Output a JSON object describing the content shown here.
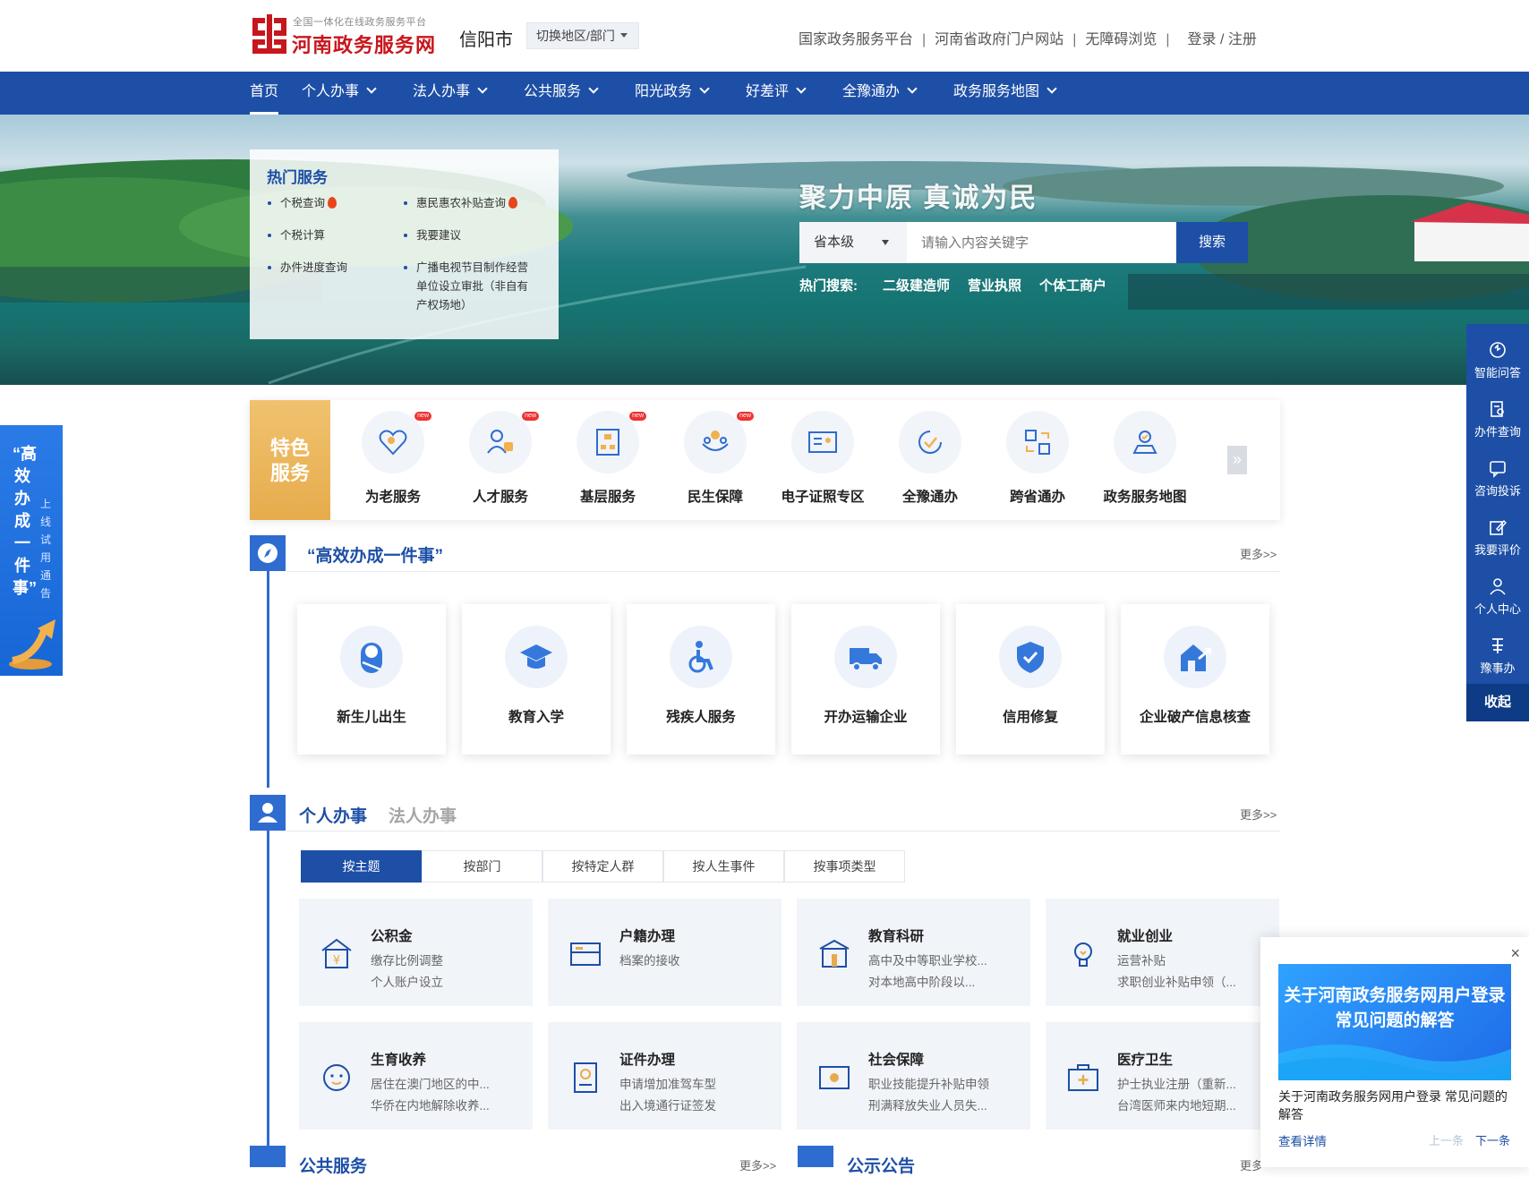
{
  "header": {
    "logo_sub": "全国一体化在线政务服务平台",
    "logo_title": "河南政务服务网",
    "city": "信阳市",
    "switch_label": "切换地区/部门",
    "links": [
      "国家政务服务平台",
      "河南省政府门户网站",
      "无障碍浏览",
      "登录 / 注册"
    ]
  },
  "nav": {
    "items": [
      "首页",
      "个人办事",
      "法人办事",
      "公共服务",
      "阳光政务",
      "好差评",
      "全豫通办",
      "政务服务地图"
    ]
  },
  "hot_services": {
    "title": "热门服务",
    "items": [
      "个税查询",
      "惠民惠农补贴查询",
      "个税计算",
      "我要建议",
      "办件进度查询",
      "广播电视节目制作经营单位设立审批（非自有产权场地）"
    ]
  },
  "search": {
    "slogan": "聚力中原  真诚为民",
    "level": "省本级",
    "placeholder": "请输入内容关键字",
    "button": "搜索",
    "hot_label": "热门搜索:",
    "hot_keywords": [
      "二级建造师",
      "营业执照",
      "个体工商户"
    ]
  },
  "right_bar": {
    "items": [
      "智能问答",
      "办件查询",
      "咨询投诉",
      "我要评价",
      "个人中心",
      "豫事办"
    ],
    "collapse": "收起"
  },
  "left_float": {
    "big": "“高效办成一件事”",
    "small": "上线试用通告"
  },
  "featured": {
    "label": "特色服务",
    "items": [
      "为老服务",
      "人才服务",
      "基层服务",
      "民生保障",
      "电子证照专区",
      "全豫通办",
      "跨省通办",
      "政务服务地图"
    ],
    "new_badge": "new"
  },
  "efficient": {
    "title": "“高效办成一件事”",
    "more": "更多>>",
    "items": [
      "新生儿出生",
      "教育入学",
      "残疾人服务",
      "开办运输企业",
      "信用修复",
      "企业破产信息核查"
    ]
  },
  "personal": {
    "title": "个人办事",
    "title2": "法人办事",
    "more": "更多>>",
    "tabs": [
      "按主题",
      "按部门",
      "按特定人群",
      "按人生事件",
      "按事项类型"
    ],
    "categories": [
      {
        "title": "公积金",
        "s1": "缴存比例调整",
        "s2": "个人账户设立"
      },
      {
        "title": "户籍办理",
        "s1": "档案的接收",
        "s2": ""
      },
      {
        "title": "教育科研",
        "s1": "高中及中等职业学校...",
        "s2": "对本地高中阶段以..."
      },
      {
        "title": "就业创业",
        "s1": "运营补贴",
        "s2": "求职创业补贴申领（..."
      },
      {
        "title": "生育收养",
        "s1": "居住在澳门地区的中...",
        "s2": "华侨在内地解除收养..."
      },
      {
        "title": "证件办理",
        "s1": "申请增加准驾车型",
        "s2": "出入境通行证签发"
      },
      {
        "title": "社会保障",
        "s1": "职业技能提升补贴申领",
        "s2": "刑满释放失业人员失..."
      },
      {
        "title": "医疗卫生",
        "s1": "护士执业注册（重新...",
        "s2": "台湾医师来内地短期..."
      }
    ]
  },
  "bottom": {
    "public_service": "公共服务",
    "public_more": "更多>>",
    "notice": "公示公告",
    "notice_more": "更多"
  },
  "popup": {
    "close": "×",
    "image_text": "关于河南政务服务网用户登录常见问题的解答",
    "text": "关于河南政务服务网用户登录 常见问题的解答",
    "detail": "查看详情",
    "prev": "上一条",
    "next": "下一条"
  },
  "colors": {
    "primary": "#1d4fa6",
    "accent_gold": "#e6ac4c",
    "logo_red": "#c8161d"
  }
}
